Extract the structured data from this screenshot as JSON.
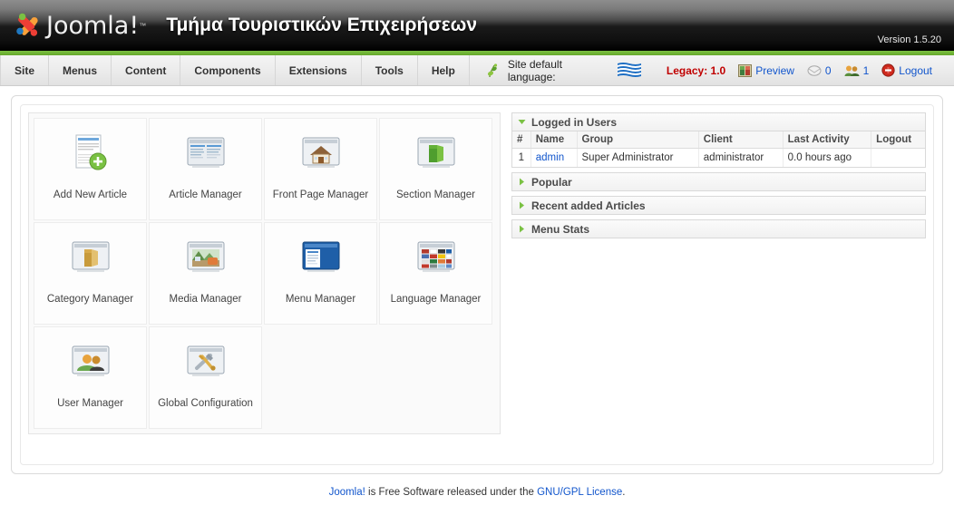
{
  "header": {
    "logo_text": "Joomla!",
    "logo_tm": "™",
    "site_title": "Τμήμα Τουριστικών Επιχειρήσεων",
    "version": "Version 1.5.20",
    "accent_green": "#6aaf2e"
  },
  "menubar": {
    "items": [
      {
        "label": "Site"
      },
      {
        "label": "Menus"
      },
      {
        "label": "Content"
      },
      {
        "label": "Components"
      },
      {
        "label": "Extensions"
      },
      {
        "label": "Tools"
      },
      {
        "label": "Help"
      }
    ]
  },
  "toolbar": {
    "language_label": "Site default language:",
    "language_flag_icon": "greek-flag-icon",
    "language_icon": "language-icon",
    "legacy_label": "Legacy: 1.0",
    "legacy_color": "#c00000",
    "preview_label": "Preview",
    "preview_icon": "preview-picture-icon",
    "messages_count": "0",
    "messages_icon": "messages-envelope-icon",
    "users_count": "1",
    "users_icon": "users-group-icon",
    "logout_label": "Logout",
    "logout_icon": "logout-icon"
  },
  "cpanel": {
    "icons": [
      {
        "label": "Add New Article",
        "icon": "add-new-article-icon"
      },
      {
        "label": "Article Manager",
        "icon": "article-manager-icon"
      },
      {
        "label": "Front Page Manager",
        "icon": "front-page-manager-icon"
      },
      {
        "label": "Section Manager",
        "icon": "section-manager-icon"
      },
      {
        "label": "Category Manager",
        "icon": "category-manager-icon"
      },
      {
        "label": "Media Manager",
        "icon": "media-manager-icon"
      },
      {
        "label": "Menu Manager",
        "icon": "menu-manager-icon"
      },
      {
        "label": "Language Manager",
        "icon": "language-manager-icon"
      },
      {
        "label": "User Manager",
        "icon": "user-manager-icon"
      },
      {
        "label": "Global Configuration",
        "icon": "global-configuration-icon"
      }
    ]
  },
  "side": {
    "logged_in_users": {
      "title": "Logged in Users",
      "expanded": true,
      "columns": [
        "#",
        "Name",
        "Group",
        "Client",
        "Last Activity",
        "Logout"
      ],
      "rows": [
        {
          "num": "1",
          "name": "admin",
          "group": "Super Administrator",
          "client": "administrator",
          "last_activity": "0.0 hours ago",
          "logout": ""
        }
      ]
    },
    "collapsed_panels": [
      {
        "title": "Popular"
      },
      {
        "title": "Recent added Articles"
      },
      {
        "title": "Menu Stats"
      }
    ]
  },
  "footer": {
    "link_joomla": "Joomla!",
    "text_middle": " is Free Software released under the ",
    "link_license": "GNU/GPL License",
    "text_end": "."
  }
}
